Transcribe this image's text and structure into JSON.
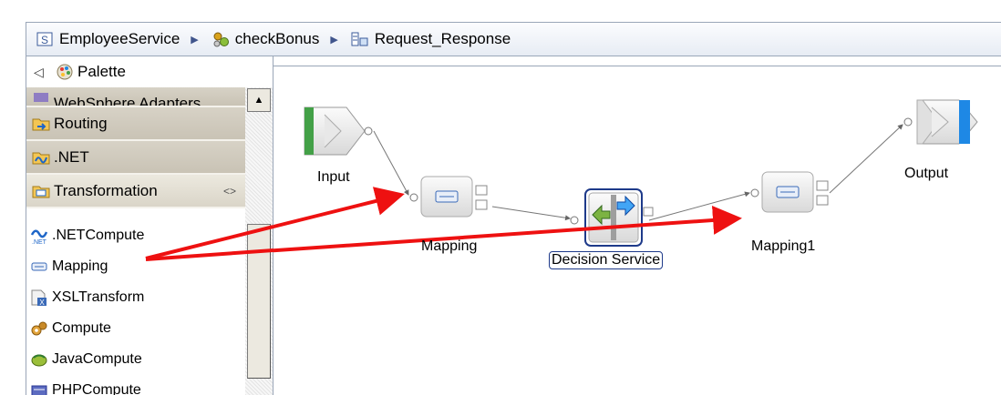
{
  "breadcrumb": {
    "items": [
      {
        "label": "EmployeeService",
        "icon": "service-icon"
      },
      {
        "label": "checkBonus",
        "icon": "operation-icon"
      },
      {
        "label": "Request_Response",
        "icon": "flow-icon"
      }
    ]
  },
  "palette": {
    "title": "Palette",
    "drawers": [
      {
        "label": "WebSphere Adapters",
        "icon": "adapters-icon"
      },
      {
        "label": "Routing",
        "icon": "routing-icon"
      },
      {
        "label": ".NET",
        "icon": "dotnet-icon"
      },
      {
        "label": "Transformation",
        "icon": "transformation-icon"
      }
    ],
    "entries": [
      {
        "label": ".NETCompute",
        "icon": "netcompute-icon"
      },
      {
        "label": "Mapping",
        "icon": "mapping-icon"
      },
      {
        "label": "XSLTransform",
        "icon": "xsl-icon"
      },
      {
        "label": "Compute",
        "icon": "compute-icon"
      },
      {
        "label": "JavaCompute",
        "icon": "javacompute-icon"
      },
      {
        "label": "PHPCompute",
        "icon": "phpcompute-icon"
      }
    ]
  },
  "canvas": {
    "nodes": [
      {
        "label": "Input"
      },
      {
        "label": "Mapping"
      },
      {
        "label": "Decision Service"
      },
      {
        "label": "Mapping1"
      },
      {
        "label": "Output"
      }
    ]
  },
  "colors": {
    "annotation_arrow": "#ee1111",
    "selection": "#1e3a8a",
    "input_node": "#43a047",
    "output_node": "#1e88e5"
  }
}
